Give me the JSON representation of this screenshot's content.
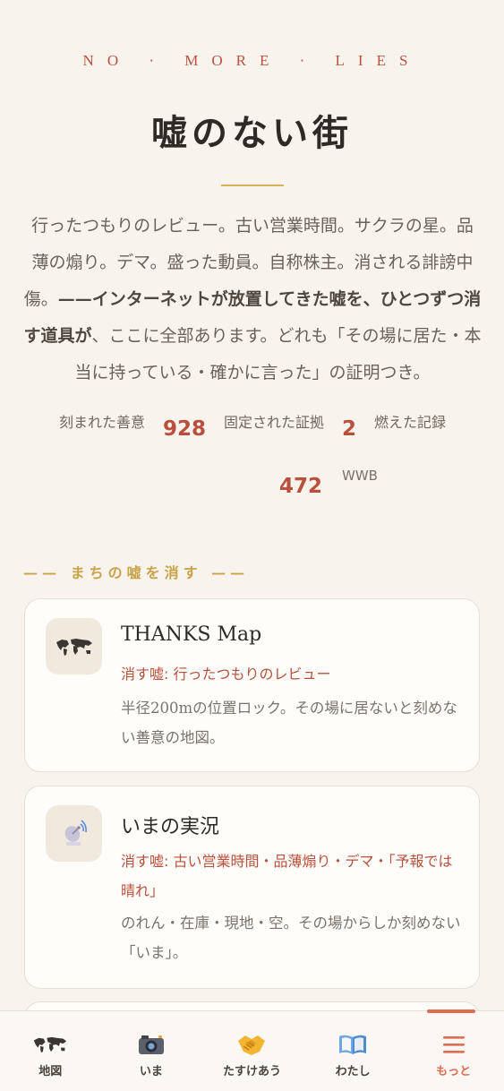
{
  "hero": {
    "eyebrow": "NO · MORE · LIES",
    "title": "嘘のない街",
    "lead_1": "行ったつもりのレビュー。古い営業時間。サクラの星。品薄の煽り。デマ。盛った動員。自称株主。消される誹謗中傷。",
    "lead_strong": "——インターネットが放置してきた嘘を、ひとつずつ消す道具が",
    "lead_2": "、ここに全部あります。どれも「その場に居た・本当に持っている・確かに言った」の証明つき。"
  },
  "stats": [
    {
      "label": "刻まれた善意",
      "value": "928"
    },
    {
      "label": "固定された証拠",
      "value": "2"
    },
    {
      "label": "燃えた記録",
      "value": "472",
      "unit": "WWB"
    }
  ],
  "section": {
    "heading": "—— まちの嘘を消す ——"
  },
  "cards": [
    {
      "icon": "world-map-icon",
      "title": "THANKS Map",
      "lie": "消す嘘: 行ったつもりのレビュー",
      "desc": "半径200mの位置ロック。その場に居ないと刻めない善意の地図。"
    },
    {
      "icon": "satellite-dish-icon",
      "title": "いまの実況",
      "lie": "消す嘘: 古い営業時間・品薄煽り・デマ・「予報では晴れ」",
      "desc": "のれん・在庫・現地・空。その場からしか刻めない「いま」。"
    }
  ],
  "tabs": [
    {
      "label": "地図",
      "icon": "world-map-icon"
    },
    {
      "label": "いま",
      "icon": "camera-icon"
    },
    {
      "label": "たすけあう",
      "icon": "handshake-icon"
    },
    {
      "label": "わたし",
      "icon": "open-book-icon"
    },
    {
      "label": "もっと",
      "icon": "menu-icon",
      "active": true
    }
  ],
  "colors": {
    "accent": "#b8503d",
    "gold": "#d9b15a",
    "tab_active": "#e06c4f",
    "background": "#f8f3ec"
  }
}
